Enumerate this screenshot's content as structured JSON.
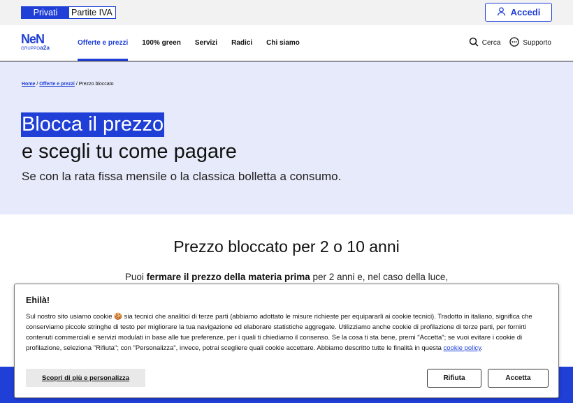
{
  "topbar": {
    "segment": [
      "Privati",
      "Partite IVA"
    ],
    "login_label": "Accedi"
  },
  "nav": {
    "logo": {
      "mark": "NeN",
      "group_prefix": "GRUPPO",
      "group_brand": "a2a"
    },
    "menu": [
      "Offerte e prezzi",
      "100% green",
      "Servizi",
      "Radici",
      "Chi siamo"
    ],
    "active_menu": "Offerte e prezzi",
    "search_label": "Cerca",
    "support_label": "Supporto"
  },
  "hero": {
    "breadcrumb": [
      "Home",
      "Offerte e prezzi",
      "Prezzo bloccato"
    ],
    "title_highlight": "Blocca il prezzo",
    "title_rest": "e scegli tu come pagare",
    "subtitle": "Se con la rata fissa mensile o la classica bolletta a consumo."
  },
  "content": {
    "heading": "Prezzo bloccato per 2 o 10 anni",
    "para_prefix": "Puoi ",
    "para_bold": "fermare il prezzo della materia prima",
    "para_suffix": " per 2 anni e, nel caso della luce,"
  },
  "cookie": {
    "title": "Ehilà!",
    "text": "Sul nostro sito usiamo cookie 🍪 sia tecnici che analitici di terze parti (abbiamo adottato le misure richieste per equipararli ai cookie tecnici). Tradotto in italiano, significa che conserviamo piccole stringhe di testo per migliorare la tua navigazione ed elaborare statistiche aggregate. Utilizziamo anche cookie di profilazione di terze parti, per fornirti contenuti commerciali e servizi modulati in base alle tue preferenze, per i quali ti chiediamo il consenso. Se la cosa ti sta bene, premi \"Accetta\"; se vuoi evitare i cookie di profilazione, seleziona \"Rifiuta\"; con \"Personalizza\", invece, potrai scegliere quali cookie accettare. Abbiamo descritto tutte le finalità in questa ",
    "policy_link": "cookie policy",
    "text_end": ".",
    "more_label": "Scopri di più e personalizza",
    "reject_label": "Rifiuta",
    "accept_label": "Accetta"
  },
  "colors": {
    "brand": "#1f3fd6",
    "hero_bg": "#e7eafa"
  },
  "icons": [
    "user-icon",
    "search-icon",
    "chat-support-icon"
  ]
}
